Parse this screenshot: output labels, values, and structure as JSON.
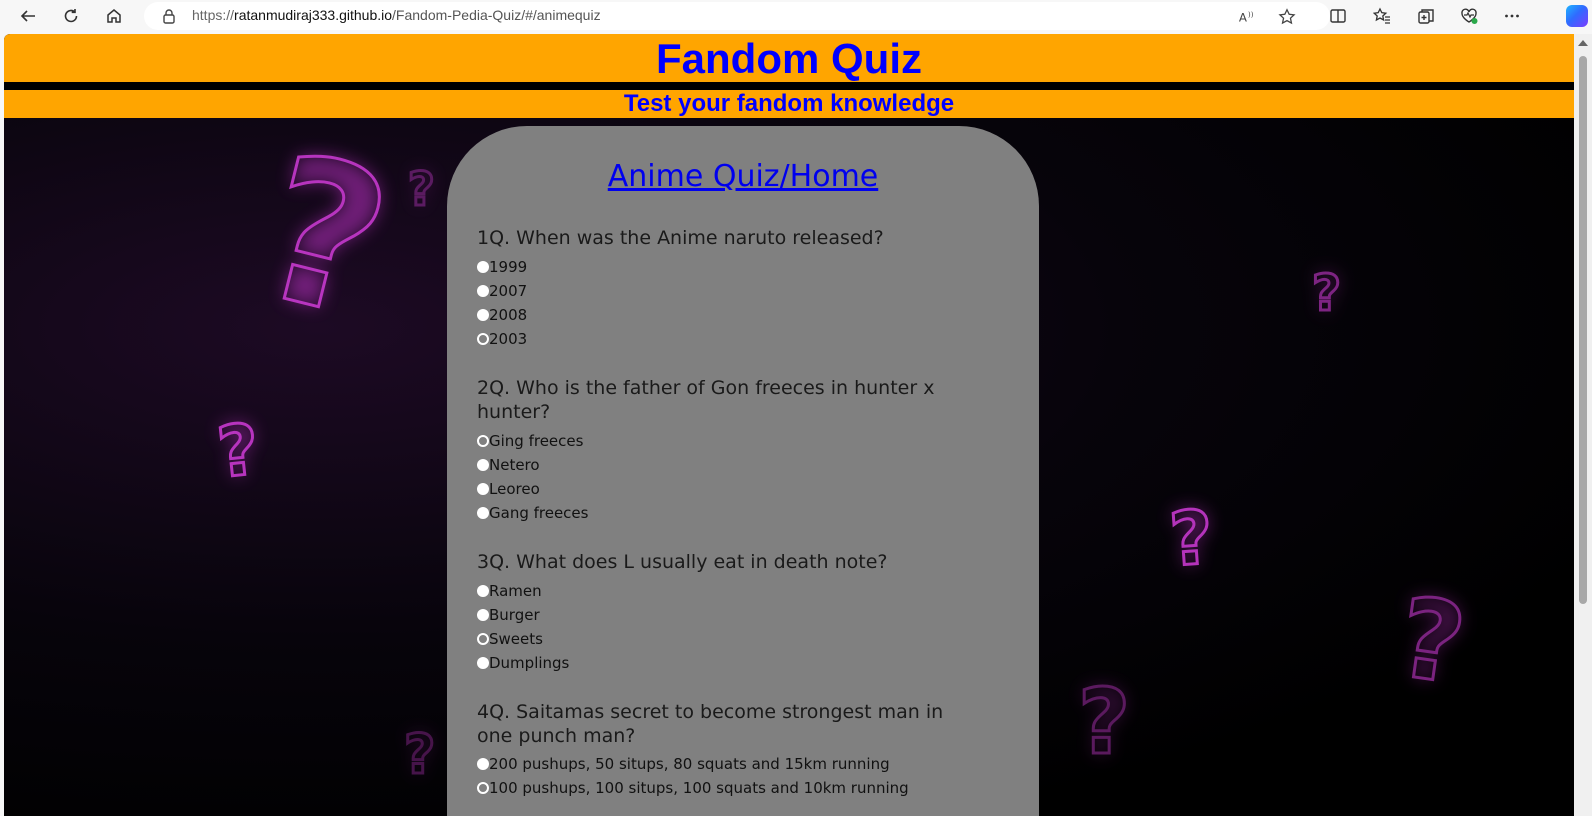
{
  "browser": {
    "url_prefix": "https://",
    "url_host": "ratanmudiraj333.github.io",
    "url_path": "/Fandom-Pedia-Quiz/#/animequiz"
  },
  "header": {
    "title": "Fandom Quiz",
    "subtitle": "Test your fandom knowledge"
  },
  "quiz": {
    "title": "Anime Quiz/Home",
    "questions": [
      {
        "text": "1Q. When was the Anime naruto released?",
        "options": [
          "1999",
          "2007",
          "2008",
          "2003"
        ]
      },
      {
        "text": "2Q. Who is the father of Gon freeces in hunter x hunter?",
        "options": [
          "Ging freeces",
          "Netero",
          "Leoreo",
          "Gang freeces"
        ]
      },
      {
        "text": "3Q. What does L usually eat in death note?",
        "options": [
          "Ramen",
          "Burger",
          "Sweets",
          "Dumplings"
        ]
      },
      {
        "text": "4Q. Saitamas secret to become strongest man in one punch man?",
        "options": [
          "200 pushups, 50 situps, 80 squats and 15km running",
          "100 pushups, 100 situps, 100 squats and 10km running"
        ]
      }
    ]
  },
  "icons": {
    "back": "back-arrow-icon",
    "refresh": "refresh-icon",
    "home": "home-icon",
    "lock": "lock-icon",
    "read_aloud": "read-aloud-icon",
    "favorite": "star-icon",
    "split_screen": "split-screen-icon",
    "favorites": "favorites-icon",
    "collections": "collections-icon",
    "health": "heart-pulse-icon",
    "more": "more-icon",
    "copilot": "copilot-icon"
  },
  "colors": {
    "header_bg": "#ffa500",
    "header_text": "#0000ff",
    "card_bg": "#808080",
    "link": "#0000ee",
    "neon": "#e040e8"
  }
}
